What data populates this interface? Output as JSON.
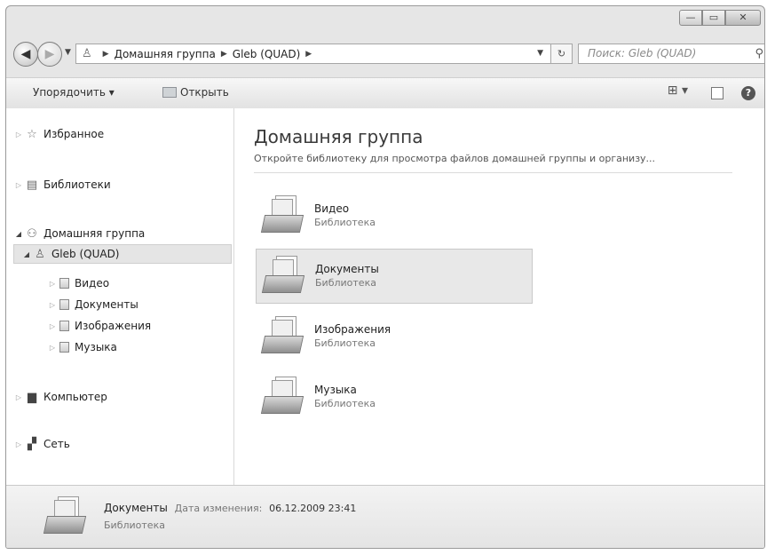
{
  "window": {
    "caption": {
      "minimize": "—",
      "maximize": "▭",
      "close": "✕"
    }
  },
  "addressbar": {
    "crumbs": [
      "Домашняя группа",
      "Gleb (QUAD)"
    ],
    "refresh": "↻",
    "search_placeholder": "Поиск: Gleb (QUAD)"
  },
  "toolbar": {
    "organize": "Упорядочить ▾",
    "open": "Открыть",
    "views": "⊞ ▾",
    "help": "?"
  },
  "nav": {
    "favorites": "Избранное",
    "libraries": "Библиотеки",
    "homegroup": "Домашняя группа",
    "user": "Gleb (QUAD)",
    "children": [
      "Видео",
      "Документы",
      "Изображения",
      "Музыка"
    ],
    "computer": "Компьютер",
    "network": "Сеть"
  },
  "main": {
    "title": "Домашняя группа",
    "subtitle": "Откройте библиотеку для просмотра файлов домашней группы и организу...",
    "items": [
      {
        "name": "Видео",
        "type": "Библиотека"
      },
      {
        "name": "Документы",
        "type": "Библиотека"
      },
      {
        "name": "Изображения",
        "type": "Библиотека"
      },
      {
        "name": "Музыка",
        "type": "Библиотека"
      }
    ]
  },
  "details": {
    "name": "Документы",
    "date_label": "Дата изменения:",
    "date_value": "06.12.2009 23:41",
    "type": "Библиотека"
  }
}
